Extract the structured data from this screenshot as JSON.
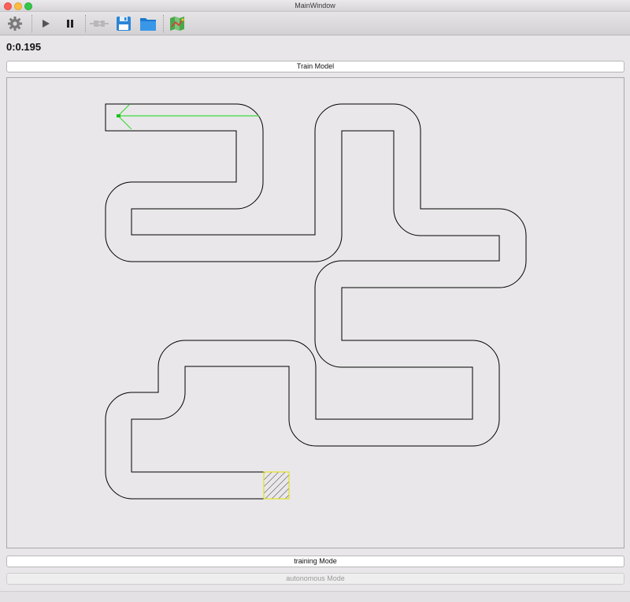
{
  "window": {
    "title": "MainWindow"
  },
  "toolbar": {
    "items": [
      {
        "icon": "gear-icon"
      },
      {
        "icon": "play-icon"
      },
      {
        "icon": "pause-icon"
      },
      {
        "icon": "connect-icon"
      },
      {
        "icon": "save-icon"
      },
      {
        "icon": "folder-icon"
      },
      {
        "icon": "map-icon"
      }
    ]
  },
  "timer": {
    "value": "0:0.195"
  },
  "buttons": {
    "train": "Train Model",
    "training_mode": "training Mode",
    "autonomous_mode": "autonomous Mode"
  },
  "colors": {
    "track_line": "#000000",
    "sensor_rays": "#3ddc3d",
    "finish_border": "#e0e000"
  }
}
